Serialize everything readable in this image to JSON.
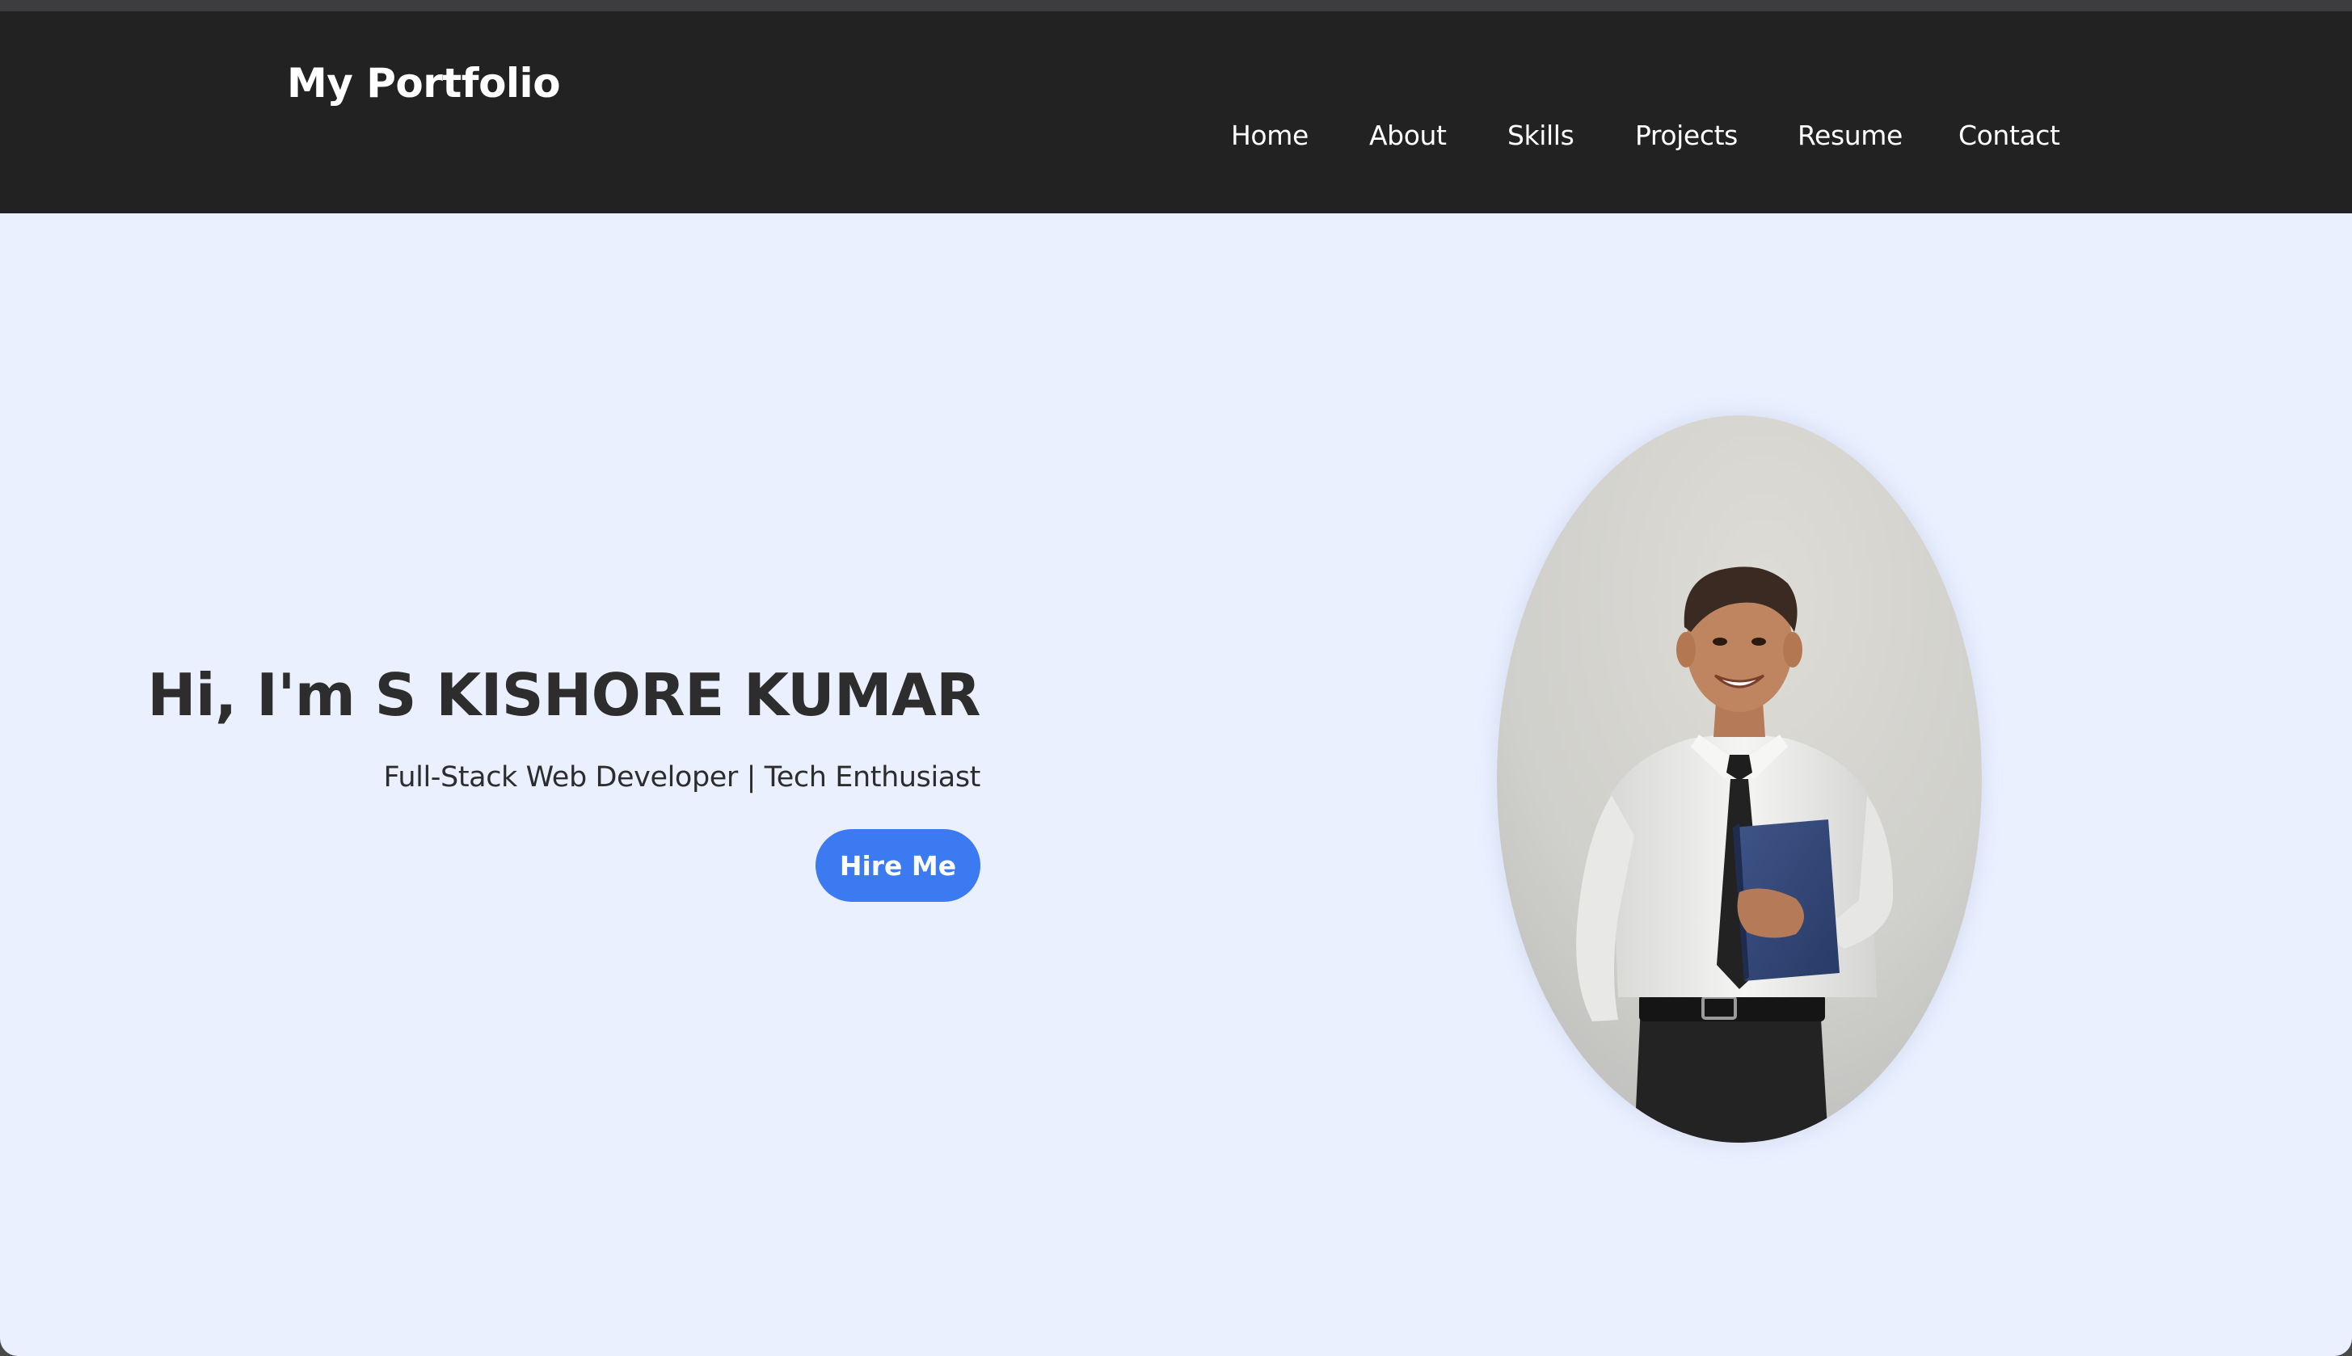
{
  "navbar": {
    "brand": "My Portfolio",
    "links": [
      {
        "label": "Home"
      },
      {
        "label": "About"
      },
      {
        "label": "Skills"
      },
      {
        "label": "Projects"
      },
      {
        "label": "Resume"
      },
      {
        "label": "Contact"
      }
    ]
  },
  "hero": {
    "title": "Hi, I'm S KISHORE KUMAR",
    "subtitle": "Full-Stack Web Developer | Tech Enthusiast",
    "cta_label": "Hire Me"
  },
  "colors": {
    "navbar_bg": "#222222",
    "hero_bg": "#eaf0fe",
    "accent": "#3b7af0",
    "text": "#2d2d2d"
  },
  "icons": {
    "portrait": "profile-photo"
  }
}
